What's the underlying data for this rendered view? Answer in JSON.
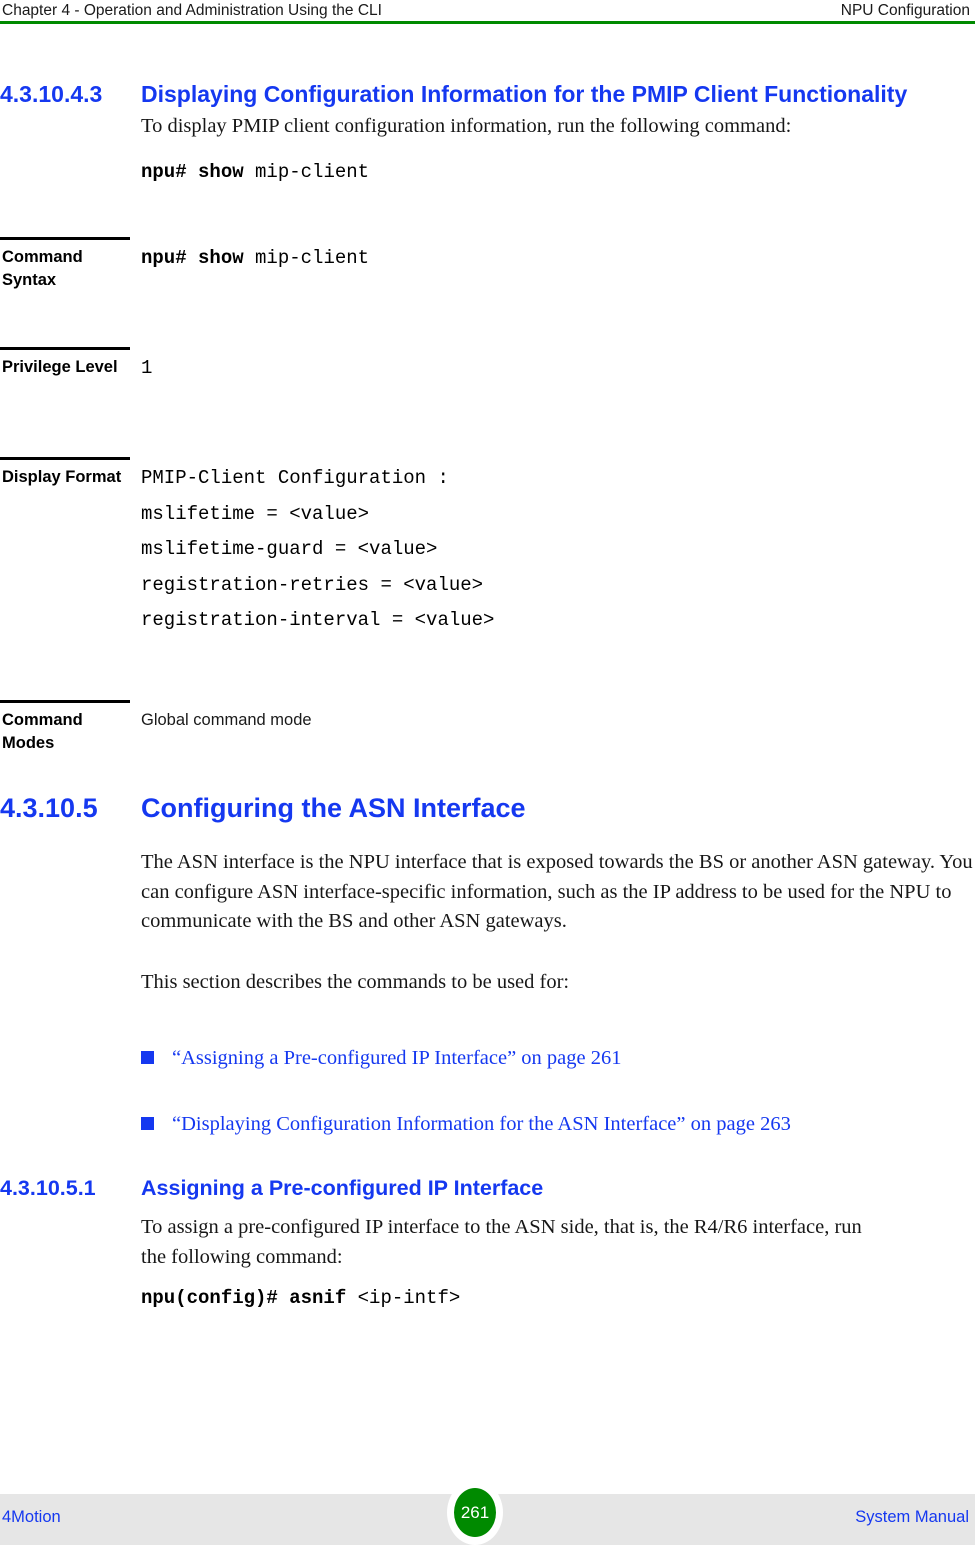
{
  "header": {
    "left": "Chapter 4 - Operation and Administration Using the CLI",
    "right": "NPU Configuration",
    "rule_color": "#008A00"
  },
  "sections": {
    "pmip_display": {
      "number": "4.3.10.4.3",
      "title": "Displaying Configuration Information for the PMIP Client Functionality",
      "intro": "To display PMIP client configuration information, run the following command:",
      "command_bold": "npu# show",
      "command_rest": " mip-client"
    },
    "asn_interface": {
      "number": "4.3.10.5",
      "title": "Configuring the ASN Interface",
      "paragraph_1": "The ASN interface is the NPU interface that is exposed towards the BS or another ASN gateway. You can configure ASN interface-specific information, such as the IP address to be used for the NPU to communicate with the BS and other ASN gateways.",
      "paragraph_2": "This section describes the commands to be used for:",
      "links": [
        "“Assigning a Pre-configured IP Interface” on page 261",
        "“Displaying Configuration Information for the ASN Interface” on page 263"
      ]
    },
    "assigning_ip": {
      "number": "4.3.10.5.1",
      "title": "Assigning a Pre-configured IP Interface",
      "intro": "To assign a pre-configured IP interface to the ASN side, that is, the R4/R6 interface, run the following command:",
      "command_bold": "npu(config)# asnif",
      "command_rest": " <ip-intf>"
    }
  },
  "command_table": {
    "rows": [
      {
        "label": "Command Syntax",
        "value_bold": "npu# show",
        "value_rest": " mip-client"
      },
      {
        "label": "Privilege Level",
        "value": "1"
      },
      {
        "label": "Display Format",
        "lines": [
          "PMIP-Client Configuration :",
          "mslifetime = <value>",
          "mslifetime-guard = <value>",
          "registration-retries = <value>",
          "registration-interval = <value>"
        ]
      },
      {
        "label": "Command Modes",
        "value": "Global command mode"
      }
    ]
  },
  "footer": {
    "left": "4Motion",
    "page_number": "261",
    "right": "System Manual",
    "badge_color": "#008A00",
    "band_color": "#E6E6E6"
  },
  "accent_color": "#1538F0"
}
